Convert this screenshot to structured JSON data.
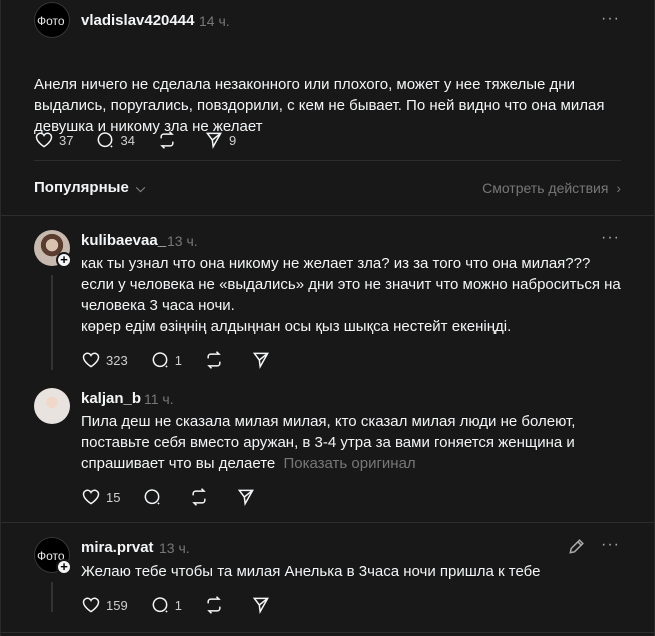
{
  "main_post": {
    "avatar_text": "Фото",
    "username": "vladislav420444",
    "time": "14 ч.",
    "text": "Анеля ничего не сделала незаконного или плохого, может у нее тяжелые дни выдались, поругались, повздорили, с кем не бывает. По ней видно что она милая девушка и никому зла не желает",
    "likes": "37",
    "replies": "34",
    "shares": "9"
  },
  "sort": {
    "label": "Популярные",
    "activity_link": "Смотреть действия"
  },
  "comments": [
    {
      "username": "kulibaevaa_",
      "time": "13 ч.",
      "text": "как ты узнал что она никому не желает зла? из за того что она милая??? если у человека не «выдались» дни это не значит что можно наброситься на человека 3 часа ночи.",
      "text2": "көрер едім өзіңнің алдыңнан осы қыз шықса нестейт екеніңді.",
      "likes": "323",
      "replies": "1"
    },
    {
      "username": "kaljan_b",
      "time": "11 ч.",
      "text": "Пила деш не сказала милая милая, кто сказал милая люди не болеют, поставьте себя вместо аружан, в 3-4 утра за вами гоняется женщина и спрашивает что вы делаете",
      "show_original": "Показать оригинал",
      "likes": "15"
    },
    {
      "avatar_text": "Фото",
      "username": "mira.prvat",
      "time": "13 ч.",
      "text": "Желаю тебе чтобы та милая Анелька в 3часа ночи пришла к тебе",
      "likes": "159",
      "replies": "1"
    }
  ]
}
